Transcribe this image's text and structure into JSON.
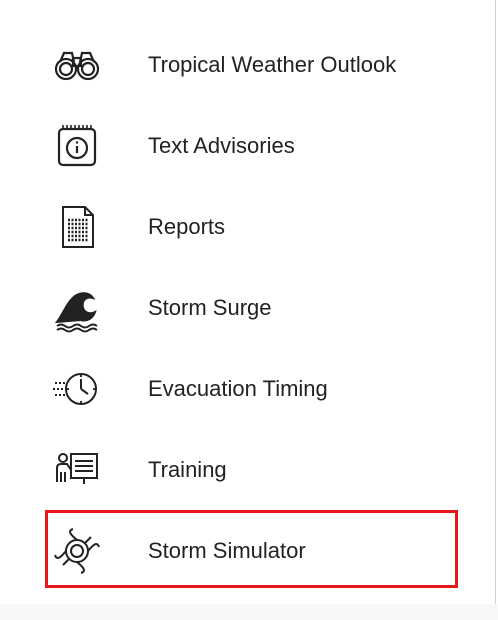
{
  "menu": {
    "items": [
      {
        "label": "Tropical Weather Outlook",
        "icon": "binoculars-icon"
      },
      {
        "label": "Text Advisories",
        "icon": "info-notepad-icon"
      },
      {
        "label": "Reports",
        "icon": "document-icon"
      },
      {
        "label": "Storm Surge",
        "icon": "wave-icon"
      },
      {
        "label": "Evacuation Timing",
        "icon": "clock-icon"
      },
      {
        "label": "Training",
        "icon": "presentation-icon"
      },
      {
        "label": "Storm Simulator",
        "icon": "hurricane-icon"
      }
    ],
    "highlighted_item": "Storm Simulator"
  },
  "colors": {
    "highlight_border": "#e3171c",
    "text": "#222222",
    "icon_stroke": "#222222"
  }
}
